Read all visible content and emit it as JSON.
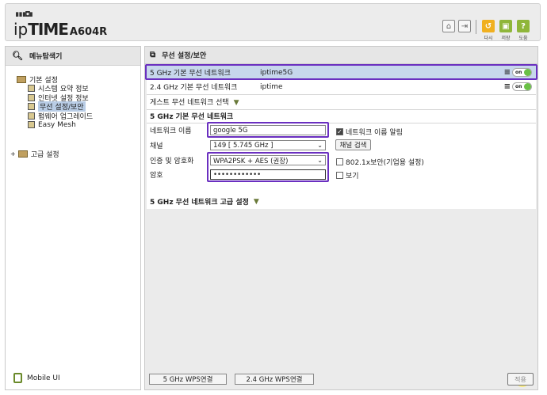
{
  "header": {
    "logo_dots": "∎∎∎◘∎",
    "logo_prefix": "ip",
    "logo_main": "TIME",
    "logo_model": "A604R",
    "buttons": [
      {
        "label": "다시",
        "color": "#f0b020"
      },
      {
        "label": "저장",
        "color": "#8fb63a"
      },
      {
        "label": "도움",
        "color": "#8fb63a"
      }
    ]
  },
  "sidebar": {
    "title": "메뉴탐색기",
    "basic_label": "기본 설정",
    "items": [
      {
        "label": "시스템 요약 정보"
      },
      {
        "label": "인터넷 설정 정보"
      },
      {
        "label": "무선 설정/보안",
        "selected": true
      },
      {
        "label": "펌웨어 업그레이드"
      },
      {
        "label": "Easy Mesh"
      }
    ],
    "advanced_label": "고급 설정",
    "mobile_label": "Mobile UI"
  },
  "main": {
    "title": "무선 설정/보안",
    "networks": [
      {
        "band": "5 GHz 기본 무선 네트워크",
        "ssid": "iptime5G",
        "state": "on"
      },
      {
        "band": "2.4 GHz 기본 무선 네트워크",
        "ssid": "iptime",
        "state": "on"
      }
    ],
    "guest_label": "게스트 무선 네트워크 선택",
    "section_title": "5 GHz 기본 무선 네트워크",
    "fields": {
      "network_name_label": "네트워크 이름",
      "network_name_value": "google 5G",
      "hide_name_label": "네트워크 이름 알림",
      "channel_label": "채널",
      "channel_value": "149 [ 5.745 GHz ]",
      "channel_scan_button": "채널 검색",
      "auth_label": "인증 및 암호화",
      "auth_value": "WPA2PSK + AES (권장)",
      "dot1x_label": "802.1x보안(기업용 설정)",
      "password_label": "암호",
      "password_value": "••••••••••••",
      "show_label": "보기"
    },
    "advanced_title": "5 GHz 무선 네트워크 고급 설정",
    "wps_5g_button": "5 GHz WPS연결",
    "wps_24g_button": "2.4 GHz WPS연결",
    "apply_button": "적용"
  }
}
